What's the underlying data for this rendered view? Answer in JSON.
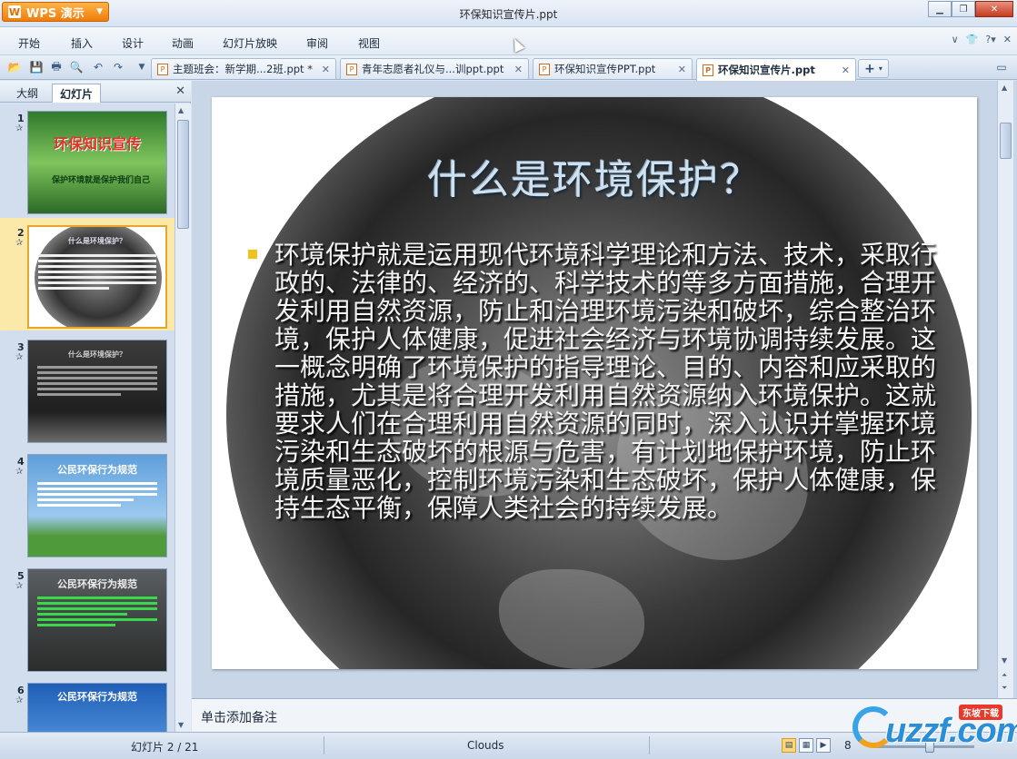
{
  "app": {
    "brand_label": "WPS 演示",
    "window_title": "环保知识宣传片.ppt"
  },
  "menu": {
    "items": [
      "开始",
      "插入",
      "设计",
      "动画",
      "幻灯片放映",
      "审阅",
      "视图"
    ]
  },
  "doc_tabs": [
    {
      "label": "主题班会：新学期...2班.ppt *",
      "active": false
    },
    {
      "label": "青年志愿者礼仪与...训ppt.ppt",
      "active": false
    },
    {
      "label": "环保知识宣传PPT.ppt",
      "active": false
    },
    {
      "label": "环保知识宣传片.ppt",
      "active": true
    }
  ],
  "left_pane": {
    "tab_outline": "大纲",
    "tab_slides": "幻灯片",
    "thumbnails": [
      {
        "num": "1",
        "title": "环保知识宣传",
        "subtitle": "保护环境就是保护我们自己",
        "selected": false
      },
      {
        "num": "2",
        "title": "什么是环境保护？",
        "selected": true
      },
      {
        "num": "3",
        "title": "什么是环境保护？",
        "selected": false
      },
      {
        "num": "4",
        "title": "公民环保行为规范",
        "selected": false
      },
      {
        "num": "5",
        "title": "公民环保行为规范",
        "selected": false
      },
      {
        "num": "6",
        "title": "公民环保行为规范",
        "selected": false
      }
    ]
  },
  "slide": {
    "title": "什么是环境保护？",
    "body": "环境保护就是运用现代环境科学理论和方法、技术，采取行政的、法律的、经济的、科学技术的等多方面措施，合理开发利用自然资源，防止和治理环境污染和破坏，综合整治环境，保护人体健康，促进社会经济与环境协调持续发展。这一概念明确了环境保护的指导理论、目的、内容和应采取的措施，尤其是将合理开发利用自然资源纳入环境保护。这就要求人们在合理利用自然资源的同时，深入认识并掌握环境污染和生态破坏的根源与危害，有计划地保护环境，防止环境质量恶化，控制环境污染和生态破坏，保护人体健康，保持生态平衡，保障人类社会的持续发展。"
  },
  "notes_placeholder": "单击添加备注",
  "status": {
    "slide_indicator": "幻灯片 2 / 21",
    "theme": "Clouds",
    "zoom_visible": "8"
  },
  "watermark": {
    "text": "uzzf.com",
    "badge": "东坡下载"
  },
  "colors": {
    "wps_orange": "#f07d0a",
    "selection": "#fbe9a9",
    "bullet": "#f2c21a"
  }
}
